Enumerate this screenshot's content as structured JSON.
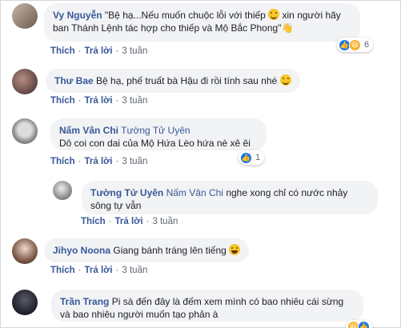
{
  "actions": {
    "like": "Thích",
    "reply": "Trả lời",
    "dot": "·"
  },
  "comments": [
    {
      "author": "Vy Nguyễn",
      "text_a": "\"Bệ hạ...Nếu muốn chuộc lỗi với thiếp",
      "text_b": "xin người hãy ban Thánh Lệnh tác hợp cho thiếp và Mộ Bắc Phong\"",
      "time": "3 tuần",
      "reaction_count": "6",
      "wave": "👋"
    },
    {
      "author": "Thư Bae",
      "text": "Bệ hạ, phế truất bà Hậu đi rồi tính sau nhé",
      "time": "3 tuần"
    },
    {
      "author": "Nấm Vân Chi",
      "tag": "Tường Tử Uyên",
      "text": "Dô coi con dai của Mộ Hứa Lèo hứa nè xê êi",
      "time": "3 tuần",
      "reaction_count": "1"
    },
    {
      "author": "Tường Tử Uyên",
      "tag": "Nấm Vân Chi",
      "text": "nghe xong chỉ có nước nhảy sông tự vẫn",
      "time": "3 tuần"
    },
    {
      "author": "Jihyo Noona",
      "text": "Giang bánh tráng lên tiếng",
      "time": "3 tuần"
    },
    {
      "author": "Trần Trang",
      "text": "Pi sà đến đây là đếm xem mình có bao nhiêu cái sừng và bao nhiêu người muốn tạo phản à"
    }
  ],
  "colors": {
    "link": "#385898",
    "bubble": "#f2f3f5",
    "like": "#1877f2",
    "haha": "#f7b125"
  },
  "icons": [
    "thumbs-up-icon",
    "haha-icon",
    "smile-emoji-icon",
    "laugh-emoji-icon",
    "waving-hand-icon"
  ]
}
